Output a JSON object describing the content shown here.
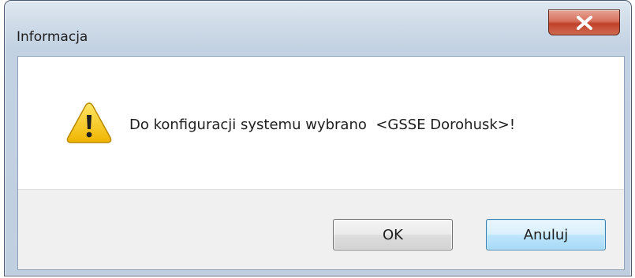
{
  "window": {
    "title": "Informacja",
    "close_icon": "close-x-icon"
  },
  "message": {
    "icon": "warning-icon",
    "text": "Do konfiguracji systemu wybrano  <GSSE Dorohusk>!"
  },
  "buttons": {
    "ok_label": "OK",
    "cancel_label": "Anuluj"
  },
  "colors": {
    "close_button": "#c0412a",
    "warning_fill": "#f5c800",
    "focus_border": "#3c7fb1"
  }
}
